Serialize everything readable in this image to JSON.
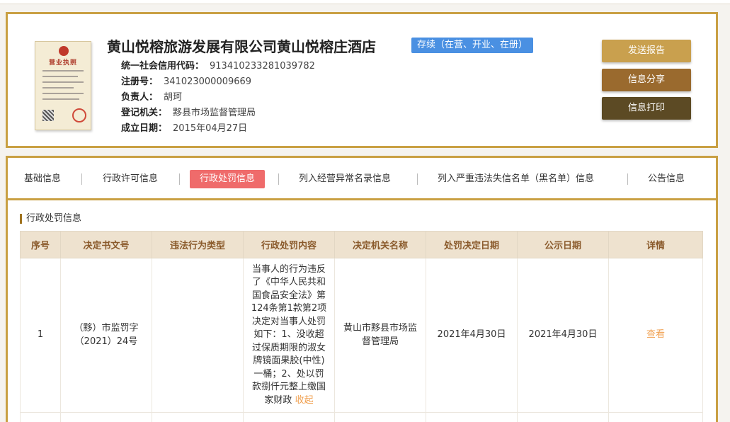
{
  "company": {
    "name": "黄山悦榕旅游发展有限公司黄山悦榕庄酒店",
    "status": "存续（在营、开业、在册）",
    "license_title": "营业执照",
    "fields": [
      {
        "label": "统一社会信用代码：",
        "value": "913410233281039782"
      },
      {
        "label": "注册号：",
        "value": "341023000009669"
      },
      {
        "label": "负责人：",
        "value": "胡珂"
      },
      {
        "label": "登记机关：",
        "value": "黟县市场监督管理局"
      },
      {
        "label": "成立日期：",
        "value": "2015年04月27日"
      }
    ]
  },
  "actions": {
    "send_report": "发送报告",
    "share": "信息分享",
    "print": "信息打印"
  },
  "tabs": [
    {
      "label": "基础信息",
      "active": false
    },
    {
      "label": "行政许可信息",
      "active": false
    },
    {
      "label": "行政处罚信息",
      "active": true
    },
    {
      "label": "列入经营异常名录信息",
      "active": false
    },
    {
      "label": "列入严重违法失信名单（黑名单）信息",
      "active": false
    },
    {
      "label": "公告信息",
      "active": false
    }
  ],
  "section": {
    "title": "行政处罚信息"
  },
  "table": {
    "headers": [
      "序号",
      "决定书文号",
      "违法行为类型",
      "行政处罚内容",
      "决定机关名称",
      "处罚决定日期",
      "公示日期",
      "详情"
    ],
    "rows": [
      {
        "index": "1",
        "doc_no": "（黟）市监罚字（2021）24号",
        "violation_type": "",
        "content": "当事人的行为违反了《中华人民共和国食品安全法》第124条第1款第2项决定对当事人处罚如下：1、没收超过保质期限的淑女牌镜面果胶(中性)一桶；2、处以罚款捌仟元整上缴国家财政",
        "collapse": "收起",
        "authority": "黄山市黟县市场监督管理局",
        "decision_date": "2021年4月30日",
        "publish_date": "2021年4月30日",
        "detail": "查看"
      }
    ]
  },
  "colors": {
    "border_gold": "#c9a043",
    "badge_blue": "#4a90e2",
    "tab_active": "#ef6b6b",
    "btn_send": "#c9a04e",
    "btn_share": "#9a6a2e",
    "btn_print": "#5c4a24",
    "header_bg": "#eee2cf",
    "link": "#f0a050"
  }
}
